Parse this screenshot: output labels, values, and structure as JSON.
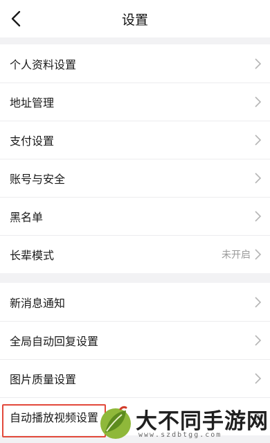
{
  "header": {
    "title": "设置",
    "back_icon": "chevron-left-icon"
  },
  "group1": [
    {
      "label": "个人资料设置",
      "value": ""
    },
    {
      "label": "地址管理",
      "value": ""
    },
    {
      "label": "支付设置",
      "value": ""
    },
    {
      "label": "账号与安全",
      "value": ""
    },
    {
      "label": "黑名单",
      "value": ""
    },
    {
      "label": "长辈模式",
      "value": "未开启"
    }
  ],
  "group2": [
    {
      "label": "新消息通知",
      "value": ""
    },
    {
      "label": "全局自动回复设置",
      "value": ""
    },
    {
      "label": "图片质量设置",
      "value": ""
    },
    {
      "label": "自动播放视频设置",
      "value": ""
    }
  ],
  "watermark": {
    "text": "大不同手游网",
    "url": "www.szdbtgg.com"
  },
  "colors": {
    "background": "#f2f2f4",
    "row_bg": "#ffffff",
    "highlight": "#e2483a",
    "chevron": "#b5b5b5",
    "value_text": "#9a9a9a"
  }
}
